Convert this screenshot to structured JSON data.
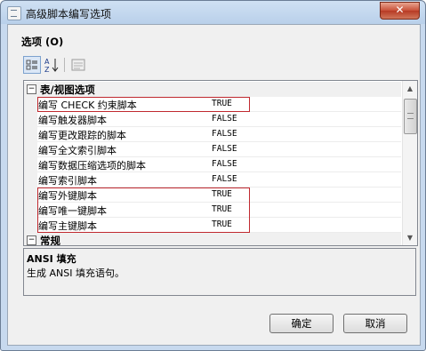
{
  "window": {
    "title": "高级脚本编写选项",
    "close_glyph": "✕"
  },
  "section_label": "选项 (O)",
  "toolbar": {
    "buttons": [
      {
        "name": "categorized",
        "icon": "categorized-view-icon",
        "selected": true
      },
      {
        "name": "alphabetical",
        "icon": "sort-az-icon",
        "selected": false
      },
      {
        "name": "property-pages",
        "icon": "property-pages-icon",
        "selected": false
      }
    ]
  },
  "grid": {
    "categories": [
      {
        "toggle": "⊟",
        "label": "表/视图选项"
      },
      {
        "toggle": "⊟",
        "label": "常规"
      }
    ],
    "properties": [
      {
        "name": "编写 CHECK 约束脚本",
        "value": "TRUE"
      },
      {
        "name": "编写触发器脚本",
        "value": "FALSE"
      },
      {
        "name": "编写更改跟踪的脚本",
        "value": "FALSE"
      },
      {
        "name": "编写全文索引脚本",
        "value": "FALSE"
      },
      {
        "name": "编写数据压缩选项的脚本",
        "value": "FALSE"
      },
      {
        "name": "编写索引脚本",
        "value": "FALSE"
      },
      {
        "name": "编写外键脚本",
        "value": "TRUE"
      },
      {
        "name": "编写唯一键脚本",
        "value": "TRUE"
      },
      {
        "name": "编写主键脚本",
        "value": "TRUE"
      }
    ],
    "scroll": {
      "up": "▲",
      "down": "▼"
    }
  },
  "description": {
    "title": "ANSI 填充",
    "text": "生成 ANSI 填充语句。"
  },
  "buttons": {
    "ok": "确定",
    "cancel": "取消"
  },
  "colors": {
    "annotation_red": "#c0292f",
    "title_bar": "#b9d0ea",
    "close_red": "#c85038"
  }
}
